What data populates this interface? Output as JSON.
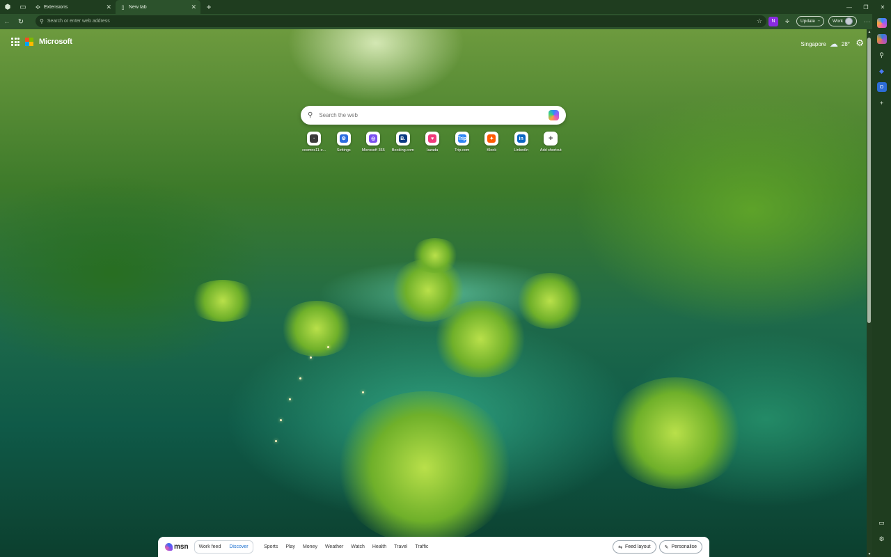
{
  "tabs": [
    {
      "label": "Extensions",
      "icon": "puzzle-icon"
    },
    {
      "label": "New tab",
      "icon": "page-icon"
    }
  ],
  "omnibox": {
    "placeholder": "Search or enter web address"
  },
  "toolbar": {
    "update_label": "Update",
    "profile_label": "Work"
  },
  "brand": {
    "name": "Microsoft"
  },
  "weather": {
    "location": "Singapore",
    "temperature": "28°"
  },
  "search": {
    "placeholder": "Search the web"
  },
  "shortcuts": [
    {
      "label": "cosmos11-e...",
      "color": "#3b3b3b",
      "glyph": "·"
    },
    {
      "label": "Settings",
      "color": "#2b6ce0",
      "glyph": "⚙"
    },
    {
      "label": "Microsoft 365",
      "color": "#7a4ff0",
      "glyph": "◎"
    },
    {
      "label": "Booking.com",
      "color": "#0a3a82",
      "glyph": "B."
    },
    {
      "label": "lazada",
      "color": "#f03a7a",
      "glyph": "♥"
    },
    {
      "label": "Trip.com",
      "color": "#2e86f5",
      "glyph": "Trip"
    },
    {
      "label": "Klook",
      "color": "#ff5b00",
      "glyph": "✦"
    },
    {
      "label": "LinkedIn",
      "color": "#0a66c2",
      "glyph": "in"
    },
    {
      "label": "Add shortcut",
      "color": "#ffffff",
      "glyph": "+"
    }
  ],
  "msn": {
    "logo_text": "msn",
    "feed_tabs": [
      "Work feed",
      "Discover"
    ],
    "active_feed": "Discover",
    "nav": [
      "Sports",
      "Play",
      "Money",
      "Weather",
      "Watch",
      "Health",
      "Travel",
      "Traffic"
    ],
    "feed_layout_label": "Feed layout",
    "personalise_label": "Personalise"
  },
  "colors": {
    "frame": "#1f3d1f",
    "toolbar": "#2c522c",
    "accent": "#1a6fd0"
  }
}
